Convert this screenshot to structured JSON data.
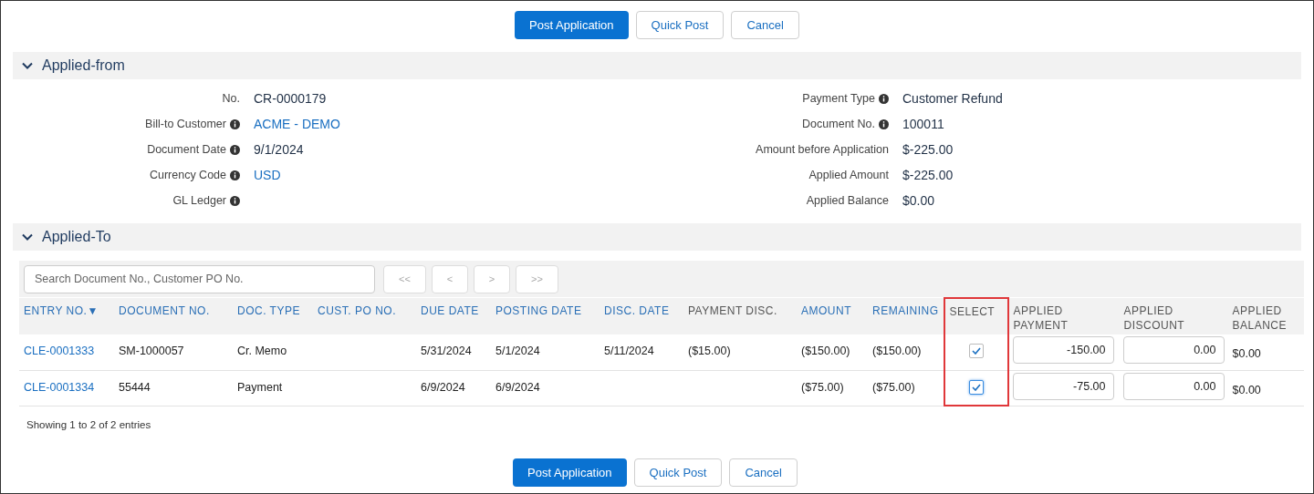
{
  "top_actions": [
    {
      "label": "Post Application",
      "primary": true
    },
    {
      "label": "Quick Post",
      "primary": false
    },
    {
      "label": "Cancel",
      "primary": false
    }
  ],
  "applied_from": {
    "title": "Applied-from",
    "expanded": true,
    "left_fields": [
      {
        "label": "No.",
        "info": false,
        "value": "CR-0000179",
        "link": false
      },
      {
        "label": "Bill-to Customer",
        "info": true,
        "value": "ACME - DEMO",
        "link": true
      },
      {
        "label": "Document Date",
        "info": true,
        "value": "9/1/2024",
        "link": false
      },
      {
        "label": "Currency Code",
        "info": true,
        "value": "USD",
        "link": true
      },
      {
        "label": "GL Ledger",
        "info": true
      }
    ],
    "right_fields": [
      {
        "label": "Payment Type",
        "info": true,
        "value": "Customer Refund",
        "link": false
      },
      {
        "label": "Document No.",
        "info": true,
        "value": "100011",
        "link": false
      },
      {
        "label": "Amount before Application",
        "info": false,
        "value": "$-225.00",
        "link": false
      },
      {
        "label": "Applied Amount",
        "info": false,
        "value": "$-225.00",
        "link": false
      },
      {
        "label": "Applied Balance",
        "info": false,
        "value": "$0.00",
        "link": false
      }
    ]
  },
  "applied_to": {
    "title": "Applied-To",
    "expanded": true,
    "search": {
      "placeholder": "Search Document No., Customer PO No."
    },
    "pager": [
      "<<",
      "<",
      ">",
      ">>"
    ],
    "columns": [
      {
        "label": "ENTRY NO.▼",
        "sortable": true,
        "highlighted": false
      },
      {
        "label": "DOCUMENT NO.",
        "sortable": true,
        "highlighted": false
      },
      {
        "label": "DOC. TYPE",
        "sortable": true,
        "highlighted": false
      },
      {
        "label": "CUST. PO NO.",
        "sortable": true,
        "highlighted": false
      },
      {
        "label": "DUE DATE",
        "sortable": true,
        "highlighted": false
      },
      {
        "label": "POSTING DATE",
        "sortable": true,
        "highlighted": false
      },
      {
        "label": "DISC. DATE",
        "sortable": true,
        "highlighted": false
      },
      {
        "label": "PAYMENT DISC.",
        "sortable": false,
        "highlighted": false
      },
      {
        "label": "AMOUNT",
        "sortable": true,
        "highlighted": false
      },
      {
        "label": "REMAINING",
        "sortable": true,
        "highlighted": false
      },
      {
        "label": "SELECT",
        "sortable": false,
        "highlighted": true
      },
      {
        "label": "APPLIED PAYMENT",
        "sortable": false,
        "highlighted": false
      },
      {
        "label": "APPLIED DISCOUNT",
        "sortable": false,
        "highlighted": false
      },
      {
        "label": "APPLIED BALANCE",
        "sortable": false,
        "highlighted": false
      }
    ],
    "rows": [
      {
        "entry_no": "CLE-0001333",
        "document_no": "SM-1000057",
        "doc_type": "Cr. Memo",
        "due_date": "5/31/2024",
        "posting_date": "5/1/2024",
        "disc_date": "5/11/2024",
        "payment_disc": "($15.00)",
        "amount": "($150.00)",
        "remaining": "($150.00)",
        "selected": true,
        "focused": false,
        "applied_payment": "-150.00",
        "applied_discount": "0.00",
        "applied_balance": "$0.00"
      },
      {
        "entry_no": "CLE-0001334",
        "document_no": "55444",
        "doc_type": "Payment",
        "due_date": "6/9/2024",
        "posting_date": "6/9/2024",
        "amount": "($75.00)",
        "remaining": "($75.00)",
        "selected": true,
        "focused": true,
        "applied_payment": "-75.00",
        "applied_discount": "0.00",
        "applied_balance": "$0.00"
      }
    ],
    "footer": "Showing 1 to 2 of 2 entries"
  },
  "bottom_actions": [
    {
      "label": "Post Application",
      "primary": true
    },
    {
      "label": "Quick Post",
      "primary": false
    },
    {
      "label": "Cancel",
      "primary": false
    }
  ]
}
